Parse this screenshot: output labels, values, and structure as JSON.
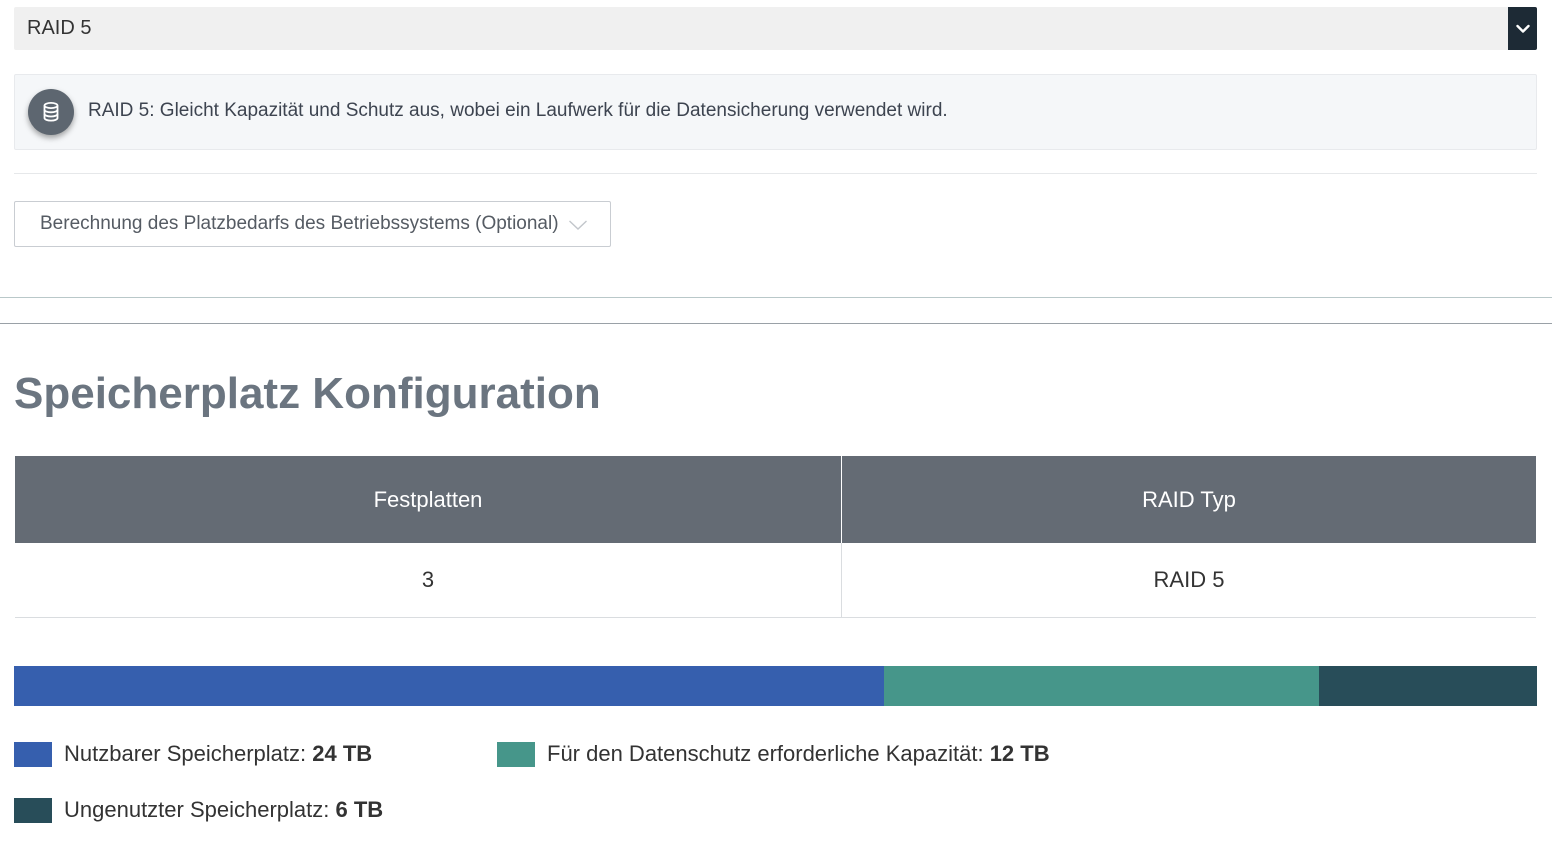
{
  "raid_select": {
    "value": "RAID 5",
    "button_icon": "chevron-down-icon"
  },
  "info": {
    "icon": "database-icon",
    "text": "RAID 5: Gleicht Kapazität und Schutz aus, wobei ein Laufwerk für die Datensicherung verwendet wird."
  },
  "os_dropdown": {
    "label": "Berechnung des Platzbedarfs des Betriebssystems (Optional)",
    "icon": "chevron-down-icon"
  },
  "section": {
    "title": "Speicherplatz Konfiguration"
  },
  "table": {
    "headers": [
      "Festplatten",
      "RAID Typ"
    ],
    "rows": [
      [
        "3",
        "RAID 5"
      ]
    ]
  },
  "storage": {
    "segments": [
      {
        "name": "usable",
        "value_tb": 24,
        "color": "#365fae"
      },
      {
        "name": "protection",
        "value_tb": 12,
        "color": "#46968a"
      },
      {
        "name": "unused",
        "value_tb": 6,
        "color": "#284d59"
      }
    ]
  },
  "legend": [
    {
      "label": "Nutzbarer Speicherplatz:",
      "value": "24 TB",
      "color": "#365fae"
    },
    {
      "label": "Für den Datenschutz erforderliche Kapazität:",
      "value": "12 TB",
      "color": "#46968a"
    },
    {
      "label": "Ungenutzter Speicherplatz:",
      "value": "6 TB",
      "color": "#284d59"
    }
  ]
}
